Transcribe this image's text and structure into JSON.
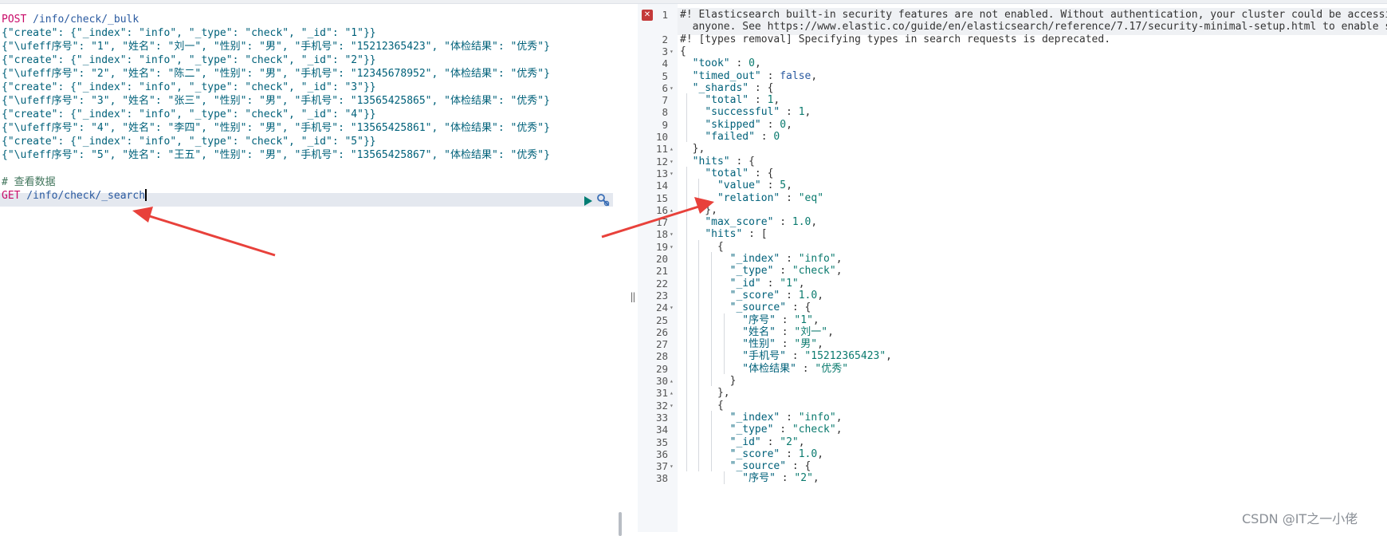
{
  "left_editor": {
    "lines": [
      [
        {
          "t": "POST",
          "c": "m"
        },
        {
          "t": " /info/check/_bulk",
          "c": "u"
        }
      ],
      [
        {
          "t": "{\"create\": {\"_index\": \"info\", \"_type\": \"check\", \"_id\": \"1\"}}",
          "c": "j"
        }
      ],
      [
        {
          "t": "{\"\\ufeff序号\": \"1\", \"姓名\": \"刘一\", \"性别\": \"男\", \"手机号\": \"15212365423\", \"体检结果\": \"优秀\"}",
          "c": "j"
        }
      ],
      [
        {
          "t": "{\"create\": {\"_index\": \"info\", \"_type\": \"check\", \"_id\": \"2\"}}",
          "c": "j"
        }
      ],
      [
        {
          "t": "{\"\\ufeff序号\": \"2\", \"姓名\": \"陈二\", \"性别\": \"男\", \"手机号\": \"12345678952\", \"体检结果\": \"优秀\"}",
          "c": "j"
        }
      ],
      [
        {
          "t": "{\"create\": {\"_index\": \"info\", \"_type\": \"check\", \"_id\": \"3\"}}",
          "c": "j"
        }
      ],
      [
        {
          "t": "{\"\\ufeff序号\": \"3\", \"姓名\": \"张三\", \"性别\": \"男\", \"手机号\": \"13565425865\", \"体检结果\": \"优秀\"}",
          "c": "j"
        }
      ],
      [
        {
          "t": "{\"create\": {\"_index\": \"info\", \"_type\": \"check\", \"_id\": \"4\"}}",
          "c": "j"
        }
      ],
      [
        {
          "t": "{\"\\ufeff序号\": \"4\", \"姓名\": \"李四\", \"性别\": \"男\", \"手机号\": \"13565425861\", \"体检结果\": \"优秀\"}",
          "c": "j"
        }
      ],
      [
        {
          "t": "{\"create\": {\"_index\": \"info\", \"_type\": \"check\", \"_id\": \"5\"}}",
          "c": "j"
        }
      ],
      [
        {
          "t": "{\"\\ufeff序号\": \"5\", \"姓名\": \"王五\", \"性别\": \"男\", \"手机号\": \"13565425867\", \"体检结果\": \"优秀\"}",
          "c": "j"
        }
      ],
      [],
      [
        {
          "t": "# 查看数据",
          "c": "c"
        }
      ],
      [
        {
          "t": "GET",
          "c": "m"
        },
        {
          "t": " /info/check/_search",
          "c": "u"
        }
      ]
    ]
  },
  "right_output": {
    "lines": [
      {
        "n": "1",
        "f": "",
        "s": [
          {
            "t": "#! Elasticsearch built-in security features are not enabled. Without authentication, your cluster could be accessible to",
            "c": "p"
          }
        ]
      },
      {
        "n": "",
        "f": "",
        "s": [
          {
            "t": "  anyone. See https://www.elastic.co/guide/en/elasticsearch/reference/7.17/security-minimal-setup.html to enable security.",
            "c": "p"
          }
        ]
      },
      {
        "n": "2",
        "f": "",
        "s": [
          {
            "t": "#! [types removal] Specifying types in search requests is deprecated.",
            "c": "p"
          }
        ]
      },
      {
        "n": "3",
        "f": "▾",
        "s": [
          {
            "t": "{",
            "c": "p"
          }
        ]
      },
      {
        "n": "4",
        "f": "",
        "s": [
          {
            "t": "  ",
            "c": "p"
          },
          {
            "t": "\"took\"",
            "c": "k"
          },
          {
            "t": " : ",
            "c": "p"
          },
          {
            "t": "0",
            "c": "n"
          },
          {
            "t": ",",
            "c": "p"
          }
        ]
      },
      {
        "n": "5",
        "f": "",
        "s": [
          {
            "t": "  ",
            "c": "p"
          },
          {
            "t": "\"timed_out\"",
            "c": "k"
          },
          {
            "t": " : ",
            "c": "p"
          },
          {
            "t": "false",
            "c": "b"
          },
          {
            "t": ",",
            "c": "p"
          }
        ]
      },
      {
        "n": "6",
        "f": "▾",
        "s": [
          {
            "t": "  ",
            "c": "p"
          },
          {
            "t": "\"_shards\"",
            "c": "k"
          },
          {
            "t": " : {",
            "c": "p"
          }
        ]
      },
      {
        "n": "7",
        "f": "",
        "s": [
          {
            "t": "    ",
            "c": "p"
          },
          {
            "t": "\"total\"",
            "c": "k"
          },
          {
            "t": " : ",
            "c": "p"
          },
          {
            "t": "1",
            "c": "n"
          },
          {
            "t": ",",
            "c": "p"
          }
        ]
      },
      {
        "n": "8",
        "f": "",
        "s": [
          {
            "t": "    ",
            "c": "p"
          },
          {
            "t": "\"successful\"",
            "c": "k"
          },
          {
            "t": " : ",
            "c": "p"
          },
          {
            "t": "1",
            "c": "n"
          },
          {
            "t": ",",
            "c": "p"
          }
        ]
      },
      {
        "n": "9",
        "f": "",
        "s": [
          {
            "t": "    ",
            "c": "p"
          },
          {
            "t": "\"skipped\"",
            "c": "k"
          },
          {
            "t": " : ",
            "c": "p"
          },
          {
            "t": "0",
            "c": "n"
          },
          {
            "t": ",",
            "c": "p"
          }
        ]
      },
      {
        "n": "10",
        "f": "",
        "s": [
          {
            "t": "    ",
            "c": "p"
          },
          {
            "t": "\"failed\"",
            "c": "k"
          },
          {
            "t": " : ",
            "c": "p"
          },
          {
            "t": "0",
            "c": "n"
          }
        ]
      },
      {
        "n": "11",
        "f": "▴",
        "s": [
          {
            "t": "  },",
            "c": "p"
          }
        ]
      },
      {
        "n": "12",
        "f": "▾",
        "s": [
          {
            "t": "  ",
            "c": "p"
          },
          {
            "t": "\"hits\"",
            "c": "k"
          },
          {
            "t": " : {",
            "c": "p"
          }
        ]
      },
      {
        "n": "13",
        "f": "▾",
        "s": [
          {
            "t": "    ",
            "c": "p"
          },
          {
            "t": "\"total\"",
            "c": "k"
          },
          {
            "t": " : {",
            "c": "p"
          }
        ]
      },
      {
        "n": "14",
        "f": "",
        "s": [
          {
            "t": "      ",
            "c": "p"
          },
          {
            "t": "\"value\"",
            "c": "k"
          },
          {
            "t": " : ",
            "c": "p"
          },
          {
            "t": "5",
            "c": "n"
          },
          {
            "t": ",",
            "c": "p"
          }
        ]
      },
      {
        "n": "15",
        "f": "",
        "s": [
          {
            "t": "      ",
            "c": "p"
          },
          {
            "t": "\"relation\"",
            "c": "k"
          },
          {
            "t": " : ",
            "c": "p"
          },
          {
            "t": "\"eq\"",
            "c": "n"
          }
        ]
      },
      {
        "n": "16",
        "f": "▴",
        "s": [
          {
            "t": "    },",
            "c": "p"
          }
        ]
      },
      {
        "n": "17",
        "f": "",
        "s": [
          {
            "t": "    ",
            "c": "p"
          },
          {
            "t": "\"max_score\"",
            "c": "k"
          },
          {
            "t": " : ",
            "c": "p"
          },
          {
            "t": "1.0",
            "c": "n"
          },
          {
            "t": ",",
            "c": "p"
          }
        ]
      },
      {
        "n": "18",
        "f": "▾",
        "s": [
          {
            "t": "    ",
            "c": "p"
          },
          {
            "t": "\"hits\"",
            "c": "k"
          },
          {
            "t": " : [",
            "c": "p"
          }
        ]
      },
      {
        "n": "19",
        "f": "▾",
        "s": [
          {
            "t": "      {",
            "c": "p"
          }
        ]
      },
      {
        "n": "20",
        "f": "",
        "s": [
          {
            "t": "        ",
            "c": "p"
          },
          {
            "t": "\"_index\"",
            "c": "k"
          },
          {
            "t": " : ",
            "c": "p"
          },
          {
            "t": "\"info\"",
            "c": "n"
          },
          {
            "t": ",",
            "c": "p"
          }
        ]
      },
      {
        "n": "21",
        "f": "",
        "s": [
          {
            "t": "        ",
            "c": "p"
          },
          {
            "t": "\"_type\"",
            "c": "k"
          },
          {
            "t": " : ",
            "c": "p"
          },
          {
            "t": "\"check\"",
            "c": "n"
          },
          {
            "t": ",",
            "c": "p"
          }
        ]
      },
      {
        "n": "22",
        "f": "",
        "s": [
          {
            "t": "        ",
            "c": "p"
          },
          {
            "t": "\"_id\"",
            "c": "k"
          },
          {
            "t": " : ",
            "c": "p"
          },
          {
            "t": "\"1\"",
            "c": "n"
          },
          {
            "t": ",",
            "c": "p"
          }
        ]
      },
      {
        "n": "23",
        "f": "",
        "s": [
          {
            "t": "        ",
            "c": "p"
          },
          {
            "t": "\"_score\"",
            "c": "k"
          },
          {
            "t": " : ",
            "c": "p"
          },
          {
            "t": "1.0",
            "c": "n"
          },
          {
            "t": ",",
            "c": "p"
          }
        ]
      },
      {
        "n": "24",
        "f": "▾",
        "s": [
          {
            "t": "        ",
            "c": "p"
          },
          {
            "t": "\"_source\"",
            "c": "k"
          },
          {
            "t": " : {",
            "c": "p"
          }
        ]
      },
      {
        "n": "25",
        "f": "",
        "s": [
          {
            "t": "          ",
            "c": "p"
          },
          {
            "t": "\"﻿序号\"",
            "c": "k"
          },
          {
            "t": " : ",
            "c": "p"
          },
          {
            "t": "\"1\"",
            "c": "n"
          },
          {
            "t": ",",
            "c": "p"
          }
        ]
      },
      {
        "n": "26",
        "f": "",
        "s": [
          {
            "t": "          ",
            "c": "p"
          },
          {
            "t": "\"姓名\"",
            "c": "k"
          },
          {
            "t": " : ",
            "c": "p"
          },
          {
            "t": "\"刘一\"",
            "c": "n"
          },
          {
            "t": ",",
            "c": "p"
          }
        ]
      },
      {
        "n": "27",
        "f": "",
        "s": [
          {
            "t": "          ",
            "c": "p"
          },
          {
            "t": "\"性别\"",
            "c": "k"
          },
          {
            "t": " : ",
            "c": "p"
          },
          {
            "t": "\"男\"",
            "c": "n"
          },
          {
            "t": ",",
            "c": "p"
          }
        ]
      },
      {
        "n": "28",
        "f": "",
        "s": [
          {
            "t": "          ",
            "c": "p"
          },
          {
            "t": "\"手机号\"",
            "c": "k"
          },
          {
            "t": " : ",
            "c": "p"
          },
          {
            "t": "\"15212365423\"",
            "c": "n"
          },
          {
            "t": ",",
            "c": "p"
          }
        ]
      },
      {
        "n": "29",
        "f": "",
        "s": [
          {
            "t": "          ",
            "c": "p"
          },
          {
            "t": "\"体检结果\"",
            "c": "k"
          },
          {
            "t": " : ",
            "c": "p"
          },
          {
            "t": "\"优秀\"",
            "c": "n"
          }
        ]
      },
      {
        "n": "30",
        "f": "▴",
        "s": [
          {
            "t": "        }",
            "c": "p"
          }
        ]
      },
      {
        "n": "31",
        "f": "▴",
        "s": [
          {
            "t": "      },",
            "c": "p"
          }
        ]
      },
      {
        "n": "32",
        "f": "▾",
        "s": [
          {
            "t": "      {",
            "c": "p"
          }
        ]
      },
      {
        "n": "33",
        "f": "",
        "s": [
          {
            "t": "        ",
            "c": "p"
          },
          {
            "t": "\"_index\"",
            "c": "k"
          },
          {
            "t": " : ",
            "c": "p"
          },
          {
            "t": "\"info\"",
            "c": "n"
          },
          {
            "t": ",",
            "c": "p"
          }
        ]
      },
      {
        "n": "34",
        "f": "",
        "s": [
          {
            "t": "        ",
            "c": "p"
          },
          {
            "t": "\"_type\"",
            "c": "k"
          },
          {
            "t": " : ",
            "c": "p"
          },
          {
            "t": "\"check\"",
            "c": "n"
          },
          {
            "t": ",",
            "c": "p"
          }
        ]
      },
      {
        "n": "35",
        "f": "",
        "s": [
          {
            "t": "        ",
            "c": "p"
          },
          {
            "t": "\"_id\"",
            "c": "k"
          },
          {
            "t": " : ",
            "c": "p"
          },
          {
            "t": "\"2\"",
            "c": "n"
          },
          {
            "t": ",",
            "c": "p"
          }
        ]
      },
      {
        "n": "36",
        "f": "",
        "s": [
          {
            "t": "        ",
            "c": "p"
          },
          {
            "t": "\"_score\"",
            "c": "k"
          },
          {
            "t": " : ",
            "c": "p"
          },
          {
            "t": "1.0",
            "c": "n"
          },
          {
            "t": ",",
            "c": "p"
          }
        ]
      },
      {
        "n": "37",
        "f": "▾",
        "s": [
          {
            "t": "        ",
            "c": "p"
          },
          {
            "t": "\"_source\"",
            "c": "k"
          },
          {
            "t": " : {",
            "c": "p"
          }
        ]
      },
      {
        "n": "38",
        "f": "",
        "s": [
          {
            "t": "          ",
            "c": "p"
          },
          {
            "t": "\"﻿序号\"",
            "c": "k"
          },
          {
            "t": " : ",
            "c": "p"
          },
          {
            "t": "\"2\"",
            "c": "n"
          },
          {
            "t": ",",
            "c": "p"
          }
        ]
      }
    ]
  },
  "toolbar": {
    "run_icon": "play-icon",
    "settings_icon": "wrench-icon",
    "error_icon": "error-x-icon"
  },
  "divider_glyph": "‖",
  "watermark": "CSDN @IT之一小佬",
  "colors": {
    "method": "#c80a68",
    "url": "#2a5aa0",
    "json": "#00617a",
    "comment": "#41755c",
    "annotation_arrow": "#e8413b",
    "run_button": "#017d73"
  }
}
